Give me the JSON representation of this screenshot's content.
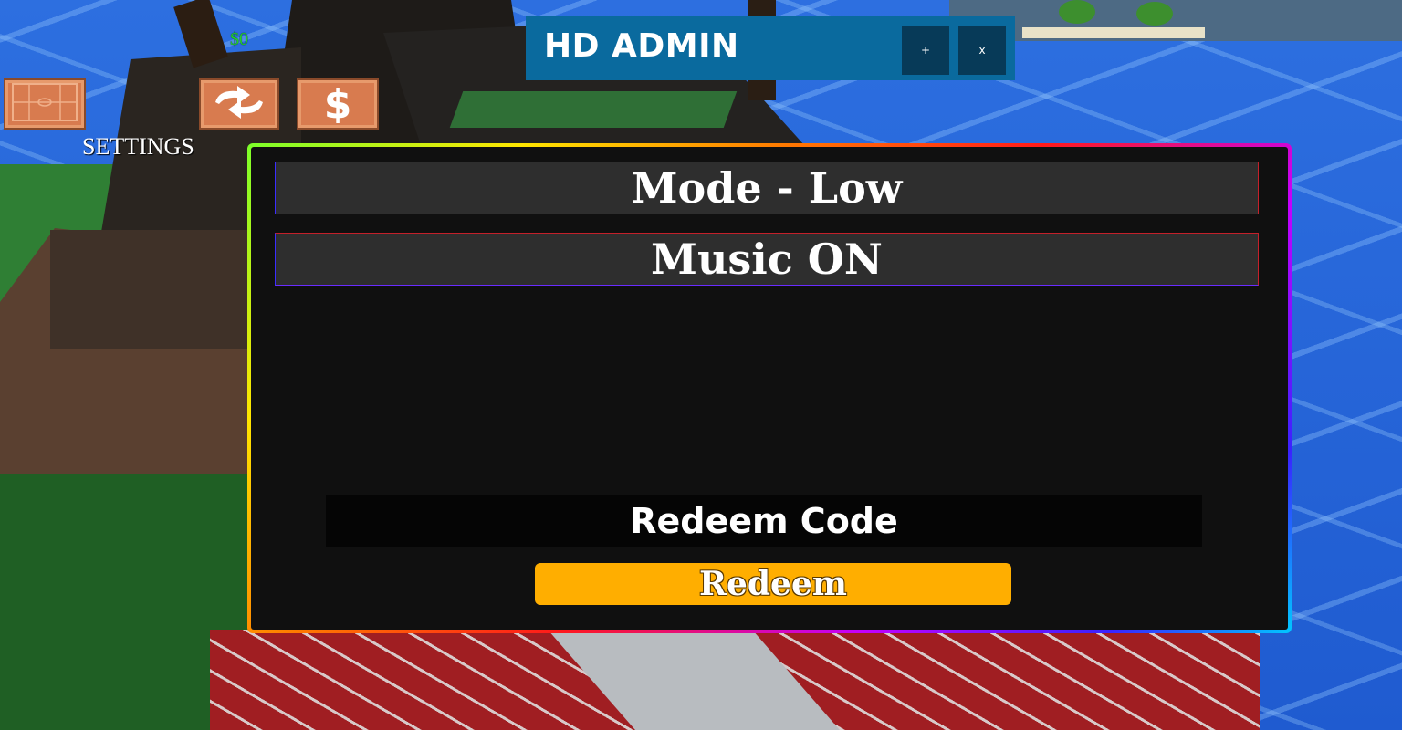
{
  "hud": {
    "money": "$0",
    "settings_label": "SETTINGS",
    "icons": [
      "settings-board-icon",
      "refresh-icon",
      "dollar-icon"
    ]
  },
  "hd_admin": {
    "title": "HD ADMIN",
    "plus_label": "+",
    "close_label": "x"
  },
  "settings_panel": {
    "mode_label": "Mode - Low",
    "music_label": "Music ON",
    "code_placeholder": "Redeem Code",
    "redeem_label": "Redeem"
  },
  "colors": {
    "hud_button": "#d87b4f",
    "hd_admin_bar": "#0a6a9e",
    "panel_bg": "#101010",
    "redeem_button": "#ffae00",
    "money_text": "#22d028"
  }
}
